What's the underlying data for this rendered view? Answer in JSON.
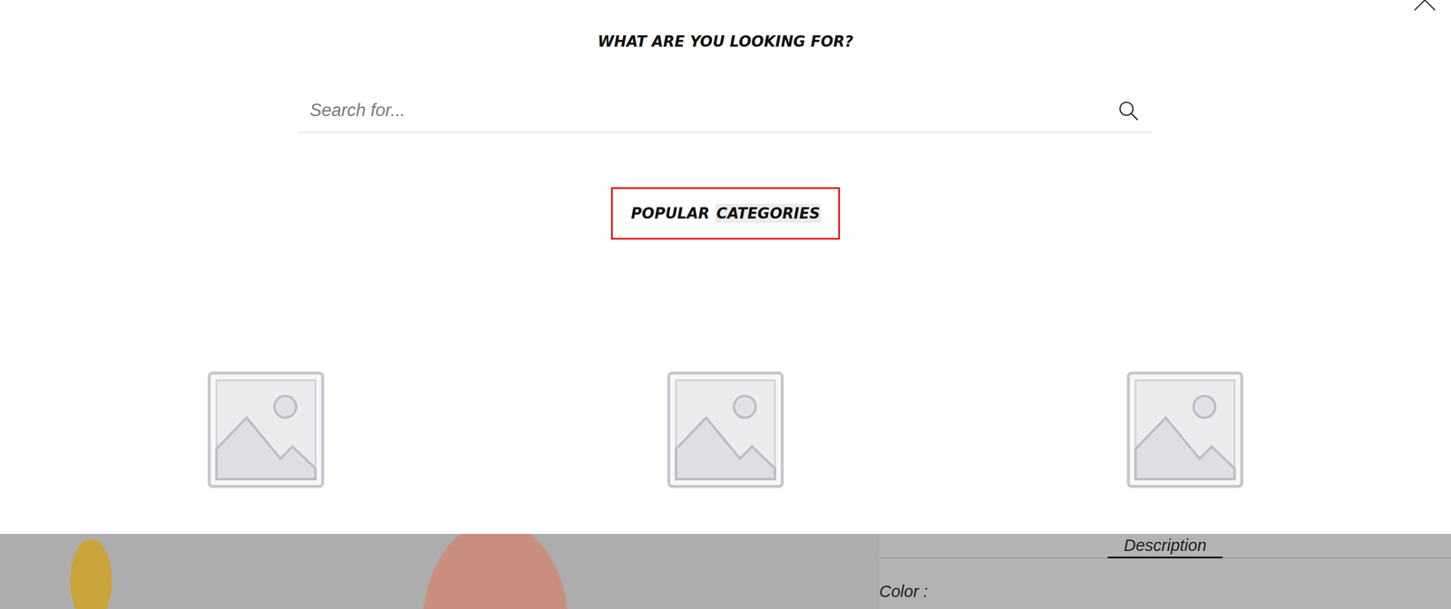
{
  "search_overlay": {
    "title": "WHAT ARE YOU LOOKING FOR?",
    "search": {
      "placeholder": "Search for..."
    },
    "heading": {
      "focused": true,
      "words": [
        {
          "text": "POPULAR",
          "highlighted": false
        },
        {
          "text": "CATEGORIES",
          "highlighted": true
        }
      ]
    },
    "categories": [
      {
        "kind": "placeholder"
      },
      {
        "kind": "placeholder"
      },
      {
        "kind": "placeholder"
      }
    ]
  },
  "product_page": {
    "tabs": [
      {
        "label": "Description",
        "selected": true
      }
    ],
    "attributes": [
      {
        "label": "Color :"
      }
    ]
  }
}
